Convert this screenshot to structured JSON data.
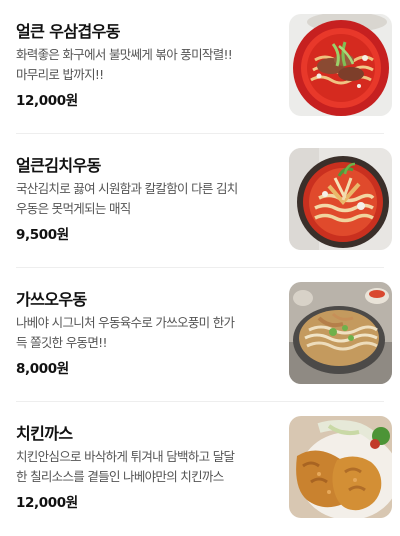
{
  "menu": {
    "items": [
      {
        "name": "얼큰 우삼겹우동",
        "desc_line1": "화력좋은 화구에서 불맛쎄게 볶아 풍미작렬!!",
        "desc_line2": "마무리로 밥까지!!",
        "price": "12,000원",
        "image_icon": "spicy-beef-udon-photo"
      },
      {
        "name": "얼큰김치우동",
        "desc_line1": "국산김치로 끓여 시원함과 칼칼함이 다른 김치",
        "desc_line2": "우동은 못먹게되는 매직",
        "price": "9,500원",
        "image_icon": "kimchi-udon-photo"
      },
      {
        "name": "가쓰오우동",
        "desc_line1": "나베야 시그니처 우동육수로 가쓰오풍미 한가",
        "desc_line2": "득 쫄깃한 우동면!!",
        "price": "8,000원",
        "image_icon": "katsuo-udon-photo"
      },
      {
        "name": "치킨까스",
        "desc_line1": "치킨안심으로 바삭하게 튀겨내 담백하고 달달",
        "desc_line2": "한 칠리소스를 곁들인 나베야만의 치킨까스",
        "price": "12,000원",
        "image_icon": "chicken-cutlet-photo"
      }
    ]
  }
}
